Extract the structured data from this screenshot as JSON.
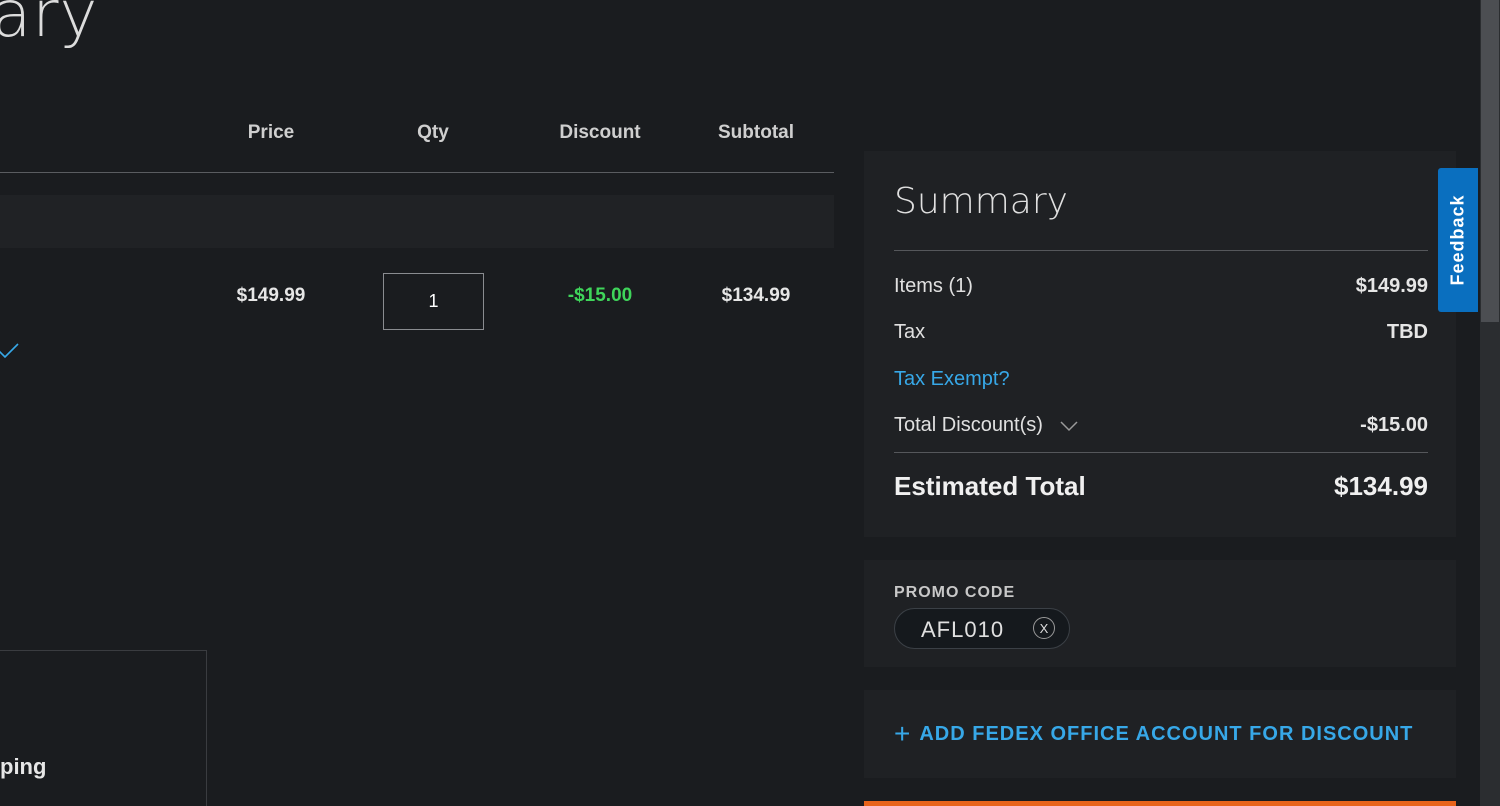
{
  "page": {
    "heading_fragment": "ary",
    "shipping_fragment": "ping"
  },
  "table": {
    "headers": {
      "price": "Price",
      "qty": "Qty",
      "discount": "Discount",
      "subtotal": "Subtotal"
    },
    "row": {
      "price": "$149.99",
      "qty": "1",
      "discount": "-$15.00",
      "subtotal": "$134.99"
    }
  },
  "summary": {
    "title": "Summary",
    "items_label": "Items (1)",
    "items_value": "$149.99",
    "tax_label": "Tax",
    "tax_value": "TBD",
    "tax_exempt_link": "Tax Exempt?",
    "discounts_label": "Total Discount(s)",
    "discounts_value": "-$15.00",
    "total_label": "Estimated Total",
    "total_value": "$134.99"
  },
  "promo": {
    "label": "PROMO CODE",
    "code": "AFL010",
    "remove_symbol": "X"
  },
  "account": {
    "plus_symbol": "+",
    "add_label": "ADD FEDEX OFFICE ACCOUNT FOR DISCOUNT"
  },
  "feedback": {
    "label": "Feedback"
  },
  "colors": {
    "background": "#1a1c1f",
    "panel": "#1f2124",
    "link_blue": "#37a8e8",
    "discount_green": "#3fd45a",
    "feedback_blue": "#0a6fbf",
    "accent_orange": "#e8641b"
  },
  "icons": {
    "row_check": "checkmark-icon",
    "discount_toggle": "chevron-down-icon",
    "add_account": "plus-icon"
  }
}
